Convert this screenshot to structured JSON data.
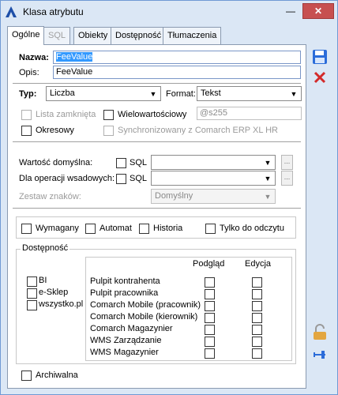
{
  "window": {
    "title": "Klasa atrybutu",
    "minimize": "—",
    "close": "✕"
  },
  "tabs": [
    {
      "label": "Ogólne",
      "state": "active"
    },
    {
      "label": "SQL",
      "state": "disabled"
    },
    {
      "label": "Obiekty",
      "state": "normal"
    },
    {
      "label": "Dostępność",
      "state": "normal"
    },
    {
      "label": "Tłumaczenia",
      "state": "normal"
    }
  ],
  "form": {
    "name_label": "Nazwa:",
    "name_value": "FeeValue",
    "desc_label": "Opis:",
    "desc_value": "FeeValue",
    "type_label": "Typ:",
    "type_value": "Liczba",
    "format_label": "Format:",
    "format_value": "Tekst",
    "closed_list_label": "Lista zamknięta",
    "multivalue_label": "Wielowartościowy",
    "multivalue_placeholder": "@s255",
    "periodic_label": "Okresowy",
    "sync_label": "Synchronizowany z Comarch ERP XL HR",
    "default_value_label": "Wartość domyślna:",
    "sql_label": "SQL",
    "for_imported_label": "Dla operacji wsadowych:",
    "charset_label": "Zestaw znaków:",
    "charset_value": "Domyślny",
    "ellipsis": "..."
  },
  "flags": {
    "required": "Wymagany",
    "automat": "Automat",
    "history": "Historia",
    "readonly": "Tylko do odczytu"
  },
  "availability": {
    "title": "Dostępność",
    "modules": [
      "BI",
      "e-Sklep",
      "wszystko.pl"
    ],
    "col_view": "Podgląd",
    "col_edit": "Edycja",
    "rows": [
      "Pulpit kontrahenta",
      "Pulpit pracownika",
      "Comarch Mobile (pracownik)",
      "Comarch Mobile (kierownik)",
      "Comarch Magazynier",
      "WMS Zarządzanie",
      "WMS Magazynier"
    ]
  },
  "archived_label": "Archiwalna",
  "colors": {
    "accent": "#2b6cd9",
    "selection": "#3399ff",
    "close": "#c75050"
  }
}
